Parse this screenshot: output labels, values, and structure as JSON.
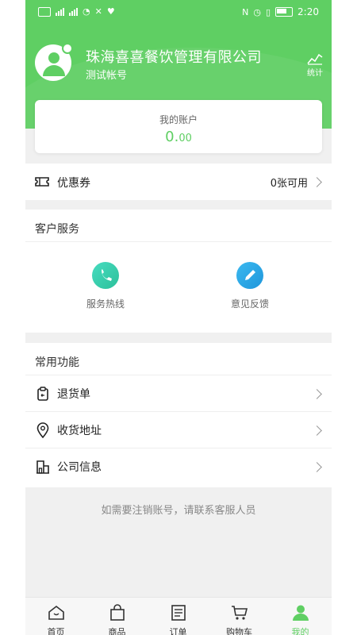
{
  "status_bar": {
    "time": "2:20"
  },
  "header": {
    "company_name": "珠海喜喜餐饮管理有限公司",
    "account_label": "测试帐号",
    "stats_label": "统计"
  },
  "account_card": {
    "title": "我的账户",
    "amount_int": "0.",
    "amount_dec": "00"
  },
  "coupon": {
    "label": "优惠券",
    "value": "0张可用"
  },
  "customer_service": {
    "title": "客户服务",
    "items": [
      {
        "label": "服务热线",
        "icon": "phone-icon",
        "color": "#3fd0b0"
      },
      {
        "label": "意见反馈",
        "icon": "edit-icon",
        "color": "#2aa8e8"
      }
    ]
  },
  "common_functions": {
    "title": "常用功能",
    "items": [
      {
        "label": "退货单",
        "icon": "return-order-icon"
      },
      {
        "label": "收货地址",
        "icon": "location-pin-icon"
      },
      {
        "label": "公司信息",
        "icon": "building-icon"
      }
    ]
  },
  "notice": "如需要注销账号，请联系客服人员",
  "bottom_nav": {
    "items": [
      {
        "label": "首页",
        "icon": "home-icon"
      },
      {
        "label": "商品",
        "icon": "shopping-bag-icon"
      },
      {
        "label": "订单",
        "icon": "order-list-icon"
      },
      {
        "label": "购物车",
        "icon": "cart-icon"
      },
      {
        "label": "我的",
        "icon": "profile-icon",
        "active": true
      }
    ]
  },
  "colors": {
    "brand_green": "#5fcf63",
    "background": "#f0f0f0"
  }
}
